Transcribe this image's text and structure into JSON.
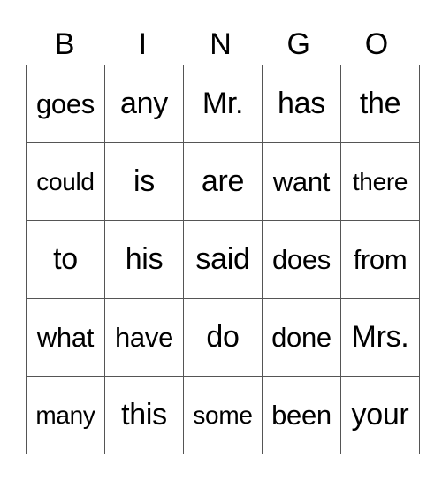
{
  "card": {
    "header": [
      "B",
      "I",
      "N",
      "G",
      "O"
    ],
    "rows": [
      [
        "goes",
        "any",
        "Mr.",
        "has",
        "the"
      ],
      [
        "could",
        "is",
        "are",
        "want",
        "there"
      ],
      [
        "to",
        "his",
        "said",
        "does",
        "from"
      ],
      [
        "what",
        "have",
        "do",
        "done",
        "Mrs."
      ],
      [
        "many",
        "this",
        "some",
        "been",
        "your"
      ]
    ]
  }
}
